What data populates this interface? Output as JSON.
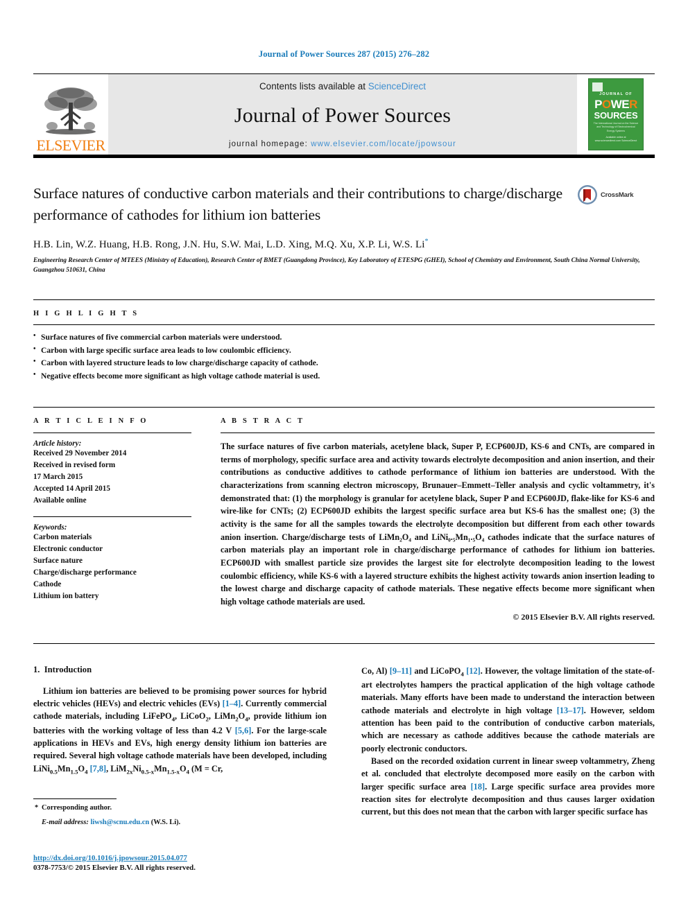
{
  "running_head": "Journal of Power Sources 287 (2015) 276–282",
  "masthead": {
    "contents_prefix": "Contents lists available at ",
    "sciencedirect": "ScienceDirect",
    "journal_name": "Journal of Power Sources",
    "homepage_prefix": "journal homepage: ",
    "homepage_url": "www.elsevier.com/locate/jpowsour",
    "publisher": "ELSEVIER",
    "cover": {
      "journal_of": "JOURNAL OF",
      "power": "POWER",
      "sources": "SOURCES",
      "subtitle": "The International Journal on the Science and Technology of Electrochemical Energy Systems",
      "footer": "Available online at www.sciencedirect.com ScienceDirect"
    },
    "accent_blue": "#3f8fd0",
    "accent_orange": "#f07f13",
    "cover_green": "#3d9a3f"
  },
  "article": {
    "title": "Surface natures of conductive carbon materials and their contributions to charge/discharge performance of cathodes for lithium ion batteries",
    "authors": "H.B. Lin, W.Z. Huang, H.B. Rong, J.N. Hu, S.W. Mai, L.D. Xing, M.Q. Xu, X.P. Li, W.S. Li",
    "author_marker": "*",
    "affiliation": "Engineering Research Center of MTEES (Ministry of Education), Research Center of BMET (Guangdong Province), Key Laboratory of ETESPG (GHEI), School of Chemistry and Environment, South China Normal University, Guangzhou 510631, China",
    "crossmark_label": "CrossMark"
  },
  "highlights": {
    "heading": "H I G H L I G H T S",
    "items": [
      "Surface natures of five commercial carbon materials were understood.",
      "Carbon with large specific surface area leads to low coulombic efficiency.",
      "Carbon with layered structure leads to low charge/discharge capacity of cathode.",
      "Negative effects become more significant as high voltage cathode material is used."
    ]
  },
  "article_info": {
    "heading": "A R T I C L E    I N F O",
    "history_label": "Article history:",
    "history": [
      "Received 29 November 2014",
      "Received in revised form",
      "17 March 2015",
      "Accepted 14 April 2015",
      "Available online"
    ],
    "keywords_label": "Keywords:",
    "keywords": [
      "Carbon materials",
      "Electronic conductor",
      "Surface nature",
      "Charge/discharge performance",
      "Cathode",
      "Lithium ion battery"
    ]
  },
  "abstract": {
    "heading": "A B S T R A C T",
    "text": "The surface natures of five carbon materials, acetylene black, Super P, ECP600JD, KS-6 and CNTs, are compared in terms of morphology, specific surface area and activity towards electrolyte decomposition and anion insertion, and their contributions as conductive additives to cathode performance of lithium ion batteries are understood. With the characterizations from scanning electron microscopy, Brunauer–Emmett–Teller analysis and cyclic voltammetry, it's demonstrated that: (1) the morphology is granular for acetylene black, Super P and ECP600JD, flake-like for KS-6 and wire-like for CNTs; (2) ECP600JD exhibits the largest specific surface area but KS-6 has the smallest one; (3) the activity is the same for all the samples towards the electrolyte decomposition but different from each other towards anion insertion. Charge/discharge tests of LiMn₂O₄ and LiNi₀.₅Mn₁.₅O₄ cathodes indicate that the surface natures of carbon materials play an important role in charge/discharge performance of cathodes for lithium ion batteries. ECP600JD with smallest particle size provides the largest site for electrolyte decomposition leading to the lowest coulombic efficiency, while KS-6 with a layered structure exhibits the highest activity towards anion insertion leading to the lowest charge and discharge capacity of cathode materials. These negative effects become more significant when high voltage cathode materials are used.",
    "copyright": "© 2015 Elsevier B.V. All rights reserved."
  },
  "introduction": {
    "section_number": "1.",
    "section_title": "Introduction",
    "left_paragraph_1": "Lithium ion batteries are believed to be promising power sources for hybrid electric vehicles (HEVs) and electric vehicles (EVs) [1–4]. Currently commercial cathode materials, including LiFePO₄, LiCoO₂, LiMn₂O₄, provide lithium ion batteries with the working voltage of less than 4.2 V [5,6]. For the large-scale applications in HEVs and EVs, high energy density lithium ion batteries are required. Several high voltage cathode materials have been developed, including LiNi₀.₅Mn₁.₅O₄ [7,8], LiM₂ₓNi₀.₅₋ₓMn₁.₅₋ₓO₄ (M = Cr,",
    "right_paragraph_1": "Co, Al) [9–11] and LiCoPO₄ [12]. However, the voltage limitation of the state-of-art electrolytes hampers the practical application of the high voltage cathode materials. Many efforts have been made to understand the interaction between cathode materials and electrolyte in high voltage [13–17]. However, seldom attention has been paid to the contribution of conductive carbon materials, which are necessary as cathode additives because the cathode materials are poorly electronic conductors.",
    "right_paragraph_2": "Based on the recorded oxidation current in linear sweep voltammetry, Zheng et al. concluded that electrolyte decomposed more easily on the carbon with larger specific surface area [18]. Large specific surface area provides more reaction sites for electrolyte decomposition and thus causes larger oxidation current, but this does not mean that the carbon with larger specific surface has"
  },
  "footnote": {
    "corresponding": "Corresponding author.",
    "email_label": "E-mail address:",
    "email": "liwsh@scnu.edu.cn",
    "email_suffix": "(W.S. Li)."
  },
  "footer": {
    "doi": "http://dx.doi.org/10.1016/j.jpowsour.2015.04.077",
    "issn": "0378-7753/© 2015 Elsevier B.V. All rights reserved."
  }
}
